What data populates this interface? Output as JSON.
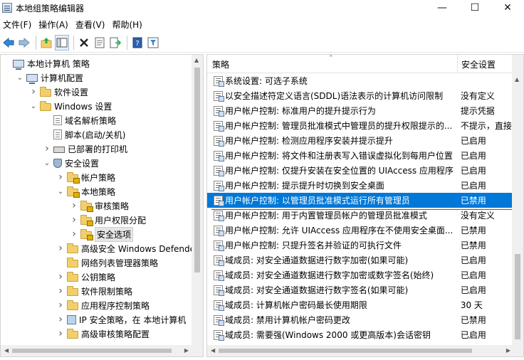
{
  "window": {
    "title": "本地组策略编辑器",
    "minimize_glyph": "—",
    "maximize_glyph": "☐",
    "close_glyph": "✕"
  },
  "menu": [
    "文件(F)",
    "操作(A)",
    "查看(V)",
    "帮助(H)"
  ],
  "toolbar_icons": [
    "back-icon",
    "forward-icon",
    "up-folder-icon",
    "show-hide-tree-icon",
    "delete-icon",
    "properties-icon",
    "export-list-icon",
    "help-icon",
    "filter-icon"
  ],
  "tree": [
    {
      "label": "本地计算机 策略",
      "level": 0,
      "icon": "computer",
      "chevron": "none"
    },
    {
      "label": "计算机配置",
      "level": 1,
      "icon": "computer",
      "chevron": "down"
    },
    {
      "label": "软件设置",
      "level": 2,
      "icon": "folder",
      "chevron": "right"
    },
    {
      "label": "Windows 设置",
      "level": 2,
      "icon": "folder",
      "chevron": "down"
    },
    {
      "label": "域名解析策略",
      "level": 3,
      "icon": "doc",
      "chevron": "none"
    },
    {
      "label": "脚本(启动/关机)",
      "level": 3,
      "icon": "doc",
      "chevron": "none"
    },
    {
      "label": "已部署的打印机",
      "level": 3,
      "icon": "printer",
      "chevron": "right"
    },
    {
      "label": "安全设置",
      "level": 3,
      "icon": "shield",
      "chevron": "down"
    },
    {
      "label": "帐户策略",
      "level": 4,
      "icon": "folder-lock",
      "chevron": "right"
    },
    {
      "label": "本地策略",
      "level": 4,
      "icon": "folder-lock",
      "chevron": "down"
    },
    {
      "label": "审核策略",
      "level": 5,
      "icon": "folder-lock",
      "chevron": "right"
    },
    {
      "label": "用户权限分配",
      "level": 5,
      "icon": "folder-lock",
      "chevron": "right"
    },
    {
      "label": "安全选项",
      "level": 5,
      "icon": "folder-lock",
      "chevron": "right",
      "selected": true
    },
    {
      "label": "高级安全 Windows Defender 防",
      "level": 4,
      "icon": "folder",
      "chevron": "right"
    },
    {
      "label": "网络列表管理器策略",
      "level": 4,
      "icon": "folder",
      "chevron": "none"
    },
    {
      "label": "公钥策略",
      "level": 4,
      "icon": "folder",
      "chevron": "right"
    },
    {
      "label": "软件限制策略",
      "level": 4,
      "icon": "folder",
      "chevron": "right"
    },
    {
      "label": "应用程序控制策略",
      "level": 4,
      "icon": "folder",
      "chevron": "right"
    },
    {
      "label": "IP 安全策略，在 本地计算机",
      "level": 4,
      "icon": "netshield",
      "chevron": "right"
    },
    {
      "label": "高级审核策略配置",
      "level": 4,
      "icon": "folder",
      "chevron": "right"
    }
  ],
  "columns": {
    "policy": "策略",
    "setting": "安全设置"
  },
  "policies": [
    {
      "name": "系统设置: 可选子系统",
      "setting": ""
    },
    {
      "name": "以安全描述符定义语言(SDDL)语法表示的计算机访问限制",
      "setting": "没有定义"
    },
    {
      "name": "用户帐户控制: 标准用户的提升提示行为",
      "setting": "提示凭据"
    },
    {
      "name": "用户帐户控制: 管理员批准模式中管理员的提升权限提示的...",
      "setting": "不提示，直接提升"
    },
    {
      "name": "用户帐户控制: 检测应用程序安装并提示提升",
      "setting": "已启用"
    },
    {
      "name": "用户帐户控制: 将文件和注册表写入错误虚拟化到每用户位置",
      "setting": "已启用"
    },
    {
      "name": "用户帐户控制: 仅提升安装在安全位置的 UIAccess 应用程序",
      "setting": "已启用"
    },
    {
      "name": "用户帐户控制: 提示提升时切换到安全桌面",
      "setting": "已启用"
    },
    {
      "name": "用户帐户控制: 以管理员批准模式运行所有管理员",
      "setting": "已禁用",
      "selected": true
    },
    {
      "name": "用户帐户控制: 用于内置管理员帐户的管理员批准模式",
      "setting": "没有定义"
    },
    {
      "name": "用户帐户控制: 允许 UIAccess 应用程序在不使用安全桌面...",
      "setting": "已禁用"
    },
    {
      "name": "用户帐户控制: 只提升签名并验证的可执行文件",
      "setting": "已禁用"
    },
    {
      "name": "域成员: 对安全通道数据进行数字加密(如果可能)",
      "setting": "已启用"
    },
    {
      "name": "域成员: 对安全通道数据进行数字加密或数字签名(始终)",
      "setting": "已启用"
    },
    {
      "name": "域成员: 对安全通道数据进行数字签名(如果可能)",
      "setting": "已启用"
    },
    {
      "name": "域成员: 计算机帐户密码最长使用期限",
      "setting": "30 天"
    },
    {
      "name": "域成员: 禁用计算机帐户密码更改",
      "setting": "已禁用"
    },
    {
      "name": "域成员: 需要强(Windows 2000 或更高版本)会话密钥",
      "setting": "已启用"
    }
  ],
  "colors": {
    "selection": "#0078d7",
    "annotation_line": "#d9262c"
  }
}
